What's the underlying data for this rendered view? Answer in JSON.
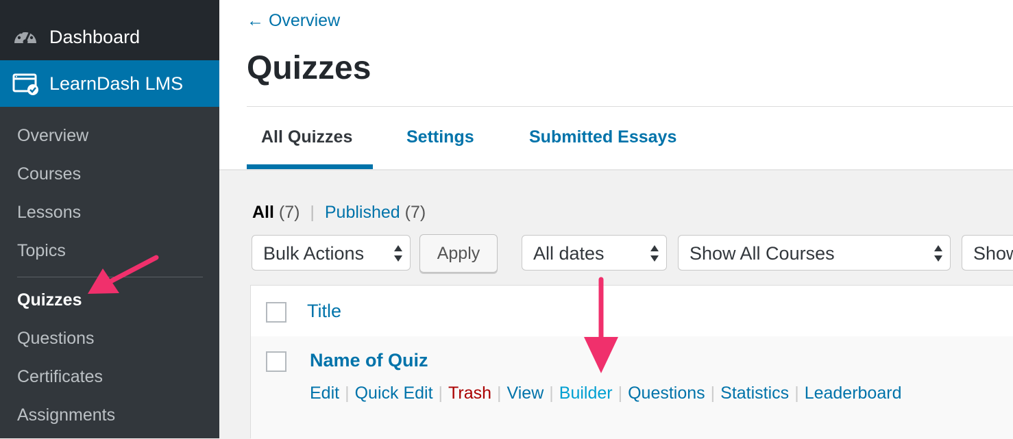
{
  "sidebar": {
    "dashboard": {
      "label": "Dashboard",
      "icon": "dashboard-gauge-icon"
    },
    "learndash": {
      "label": "LearnDash LMS",
      "icon": "learndash-window-icon"
    },
    "submenu": [
      {
        "label": "Overview"
      },
      {
        "label": "Courses"
      },
      {
        "label": "Lessons"
      },
      {
        "label": "Topics"
      },
      {
        "label": "Quizzes",
        "current": true
      },
      {
        "label": "Questions"
      },
      {
        "label": "Certificates"
      },
      {
        "label": "Assignments"
      }
    ]
  },
  "header": {
    "back_link": "← Overview",
    "title": "Quizzes",
    "tabs": [
      {
        "label": "All Quizzes",
        "active": true
      },
      {
        "label": "Settings"
      },
      {
        "label": "Submitted Essays"
      }
    ]
  },
  "filters": {
    "status": {
      "all_label": "All",
      "all_count": "(7)",
      "separator": "|",
      "published_label": "Published",
      "published_count": "(7)"
    },
    "bulk_actions": "Bulk Actions",
    "apply": "Apply",
    "dates": "All dates",
    "courses": "Show All Courses",
    "third_select": "Show"
  },
  "table": {
    "column_title": "Title",
    "rows": [
      {
        "name": "Name of Quiz",
        "actions": [
          "Edit",
          "Quick Edit",
          "Trash",
          "View",
          "Builder",
          "Questions",
          "Statistics",
          "Leaderboard"
        ]
      }
    ]
  },
  "colors": {
    "sidebar_bg": "#23282d",
    "submenu_bg": "#32373c",
    "accent": "#0073aa",
    "trash": "#aa0000",
    "annotation_arrow": "#f0306c"
  }
}
